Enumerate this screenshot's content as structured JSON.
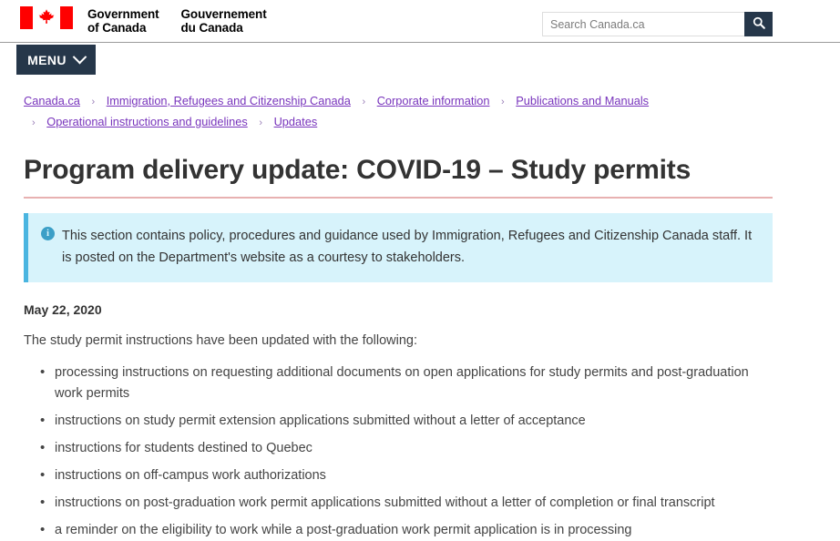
{
  "header": {
    "logo_alt": "Government of Canada / Gouvernement du Canada",
    "brand_en": "Government\nof Canada",
    "brand_fr": "Gouvernement\ndu Canada",
    "search": {
      "placeholder": "Search Canada.ca",
      "value": "",
      "button_icon": "search-icon",
      "button_label": "Search"
    }
  },
  "menu": {
    "label": "MENU",
    "chevron_icon": "chevron-down-icon"
  },
  "breadcrumb": {
    "separator": "›",
    "items": [
      {
        "label": "Canada.ca"
      },
      {
        "label": "Immigration, Refugees and Citizenship Canada"
      },
      {
        "label": "Corporate information"
      },
      {
        "label": "Publications and Manuals"
      },
      {
        "label": "Operational instructions and guidelines"
      },
      {
        "label": "Updates"
      }
    ]
  },
  "page": {
    "title": "Program delivery update: COVID-19 – Study permits",
    "notice": {
      "icon": "info-icon",
      "text": "This section contains policy, procedures and guidance used by Immigration, Refugees and Citizenship Canada staff. It is posted on the Department's website as a courtesy to stakeholders."
    },
    "date": "May 22, 2020",
    "intro": "The study permit instructions have been updated with the following:",
    "updates": [
      "processing instructions on requesting additional documents on open applications for study permits and post-graduation work permits",
      "instructions on study permit extension applications submitted without a letter of acceptance",
      "instructions for students destined to Quebec",
      "instructions on off-campus work authorizations",
      "instructions on post-graduation work permit applications submitted without a letter of completion or final transcript",
      "a reminder on the eligibility to work while a post-graduation work permit application is in processing"
    ]
  },
  "colors": {
    "nav_dark": "#26374a",
    "flag_red": "#ff0000",
    "title_underline": "#e8b1b1",
    "notice_bg": "#d7f3fb",
    "notice_border": "#4ab5e0",
    "link_visited": "#7834bc"
  }
}
